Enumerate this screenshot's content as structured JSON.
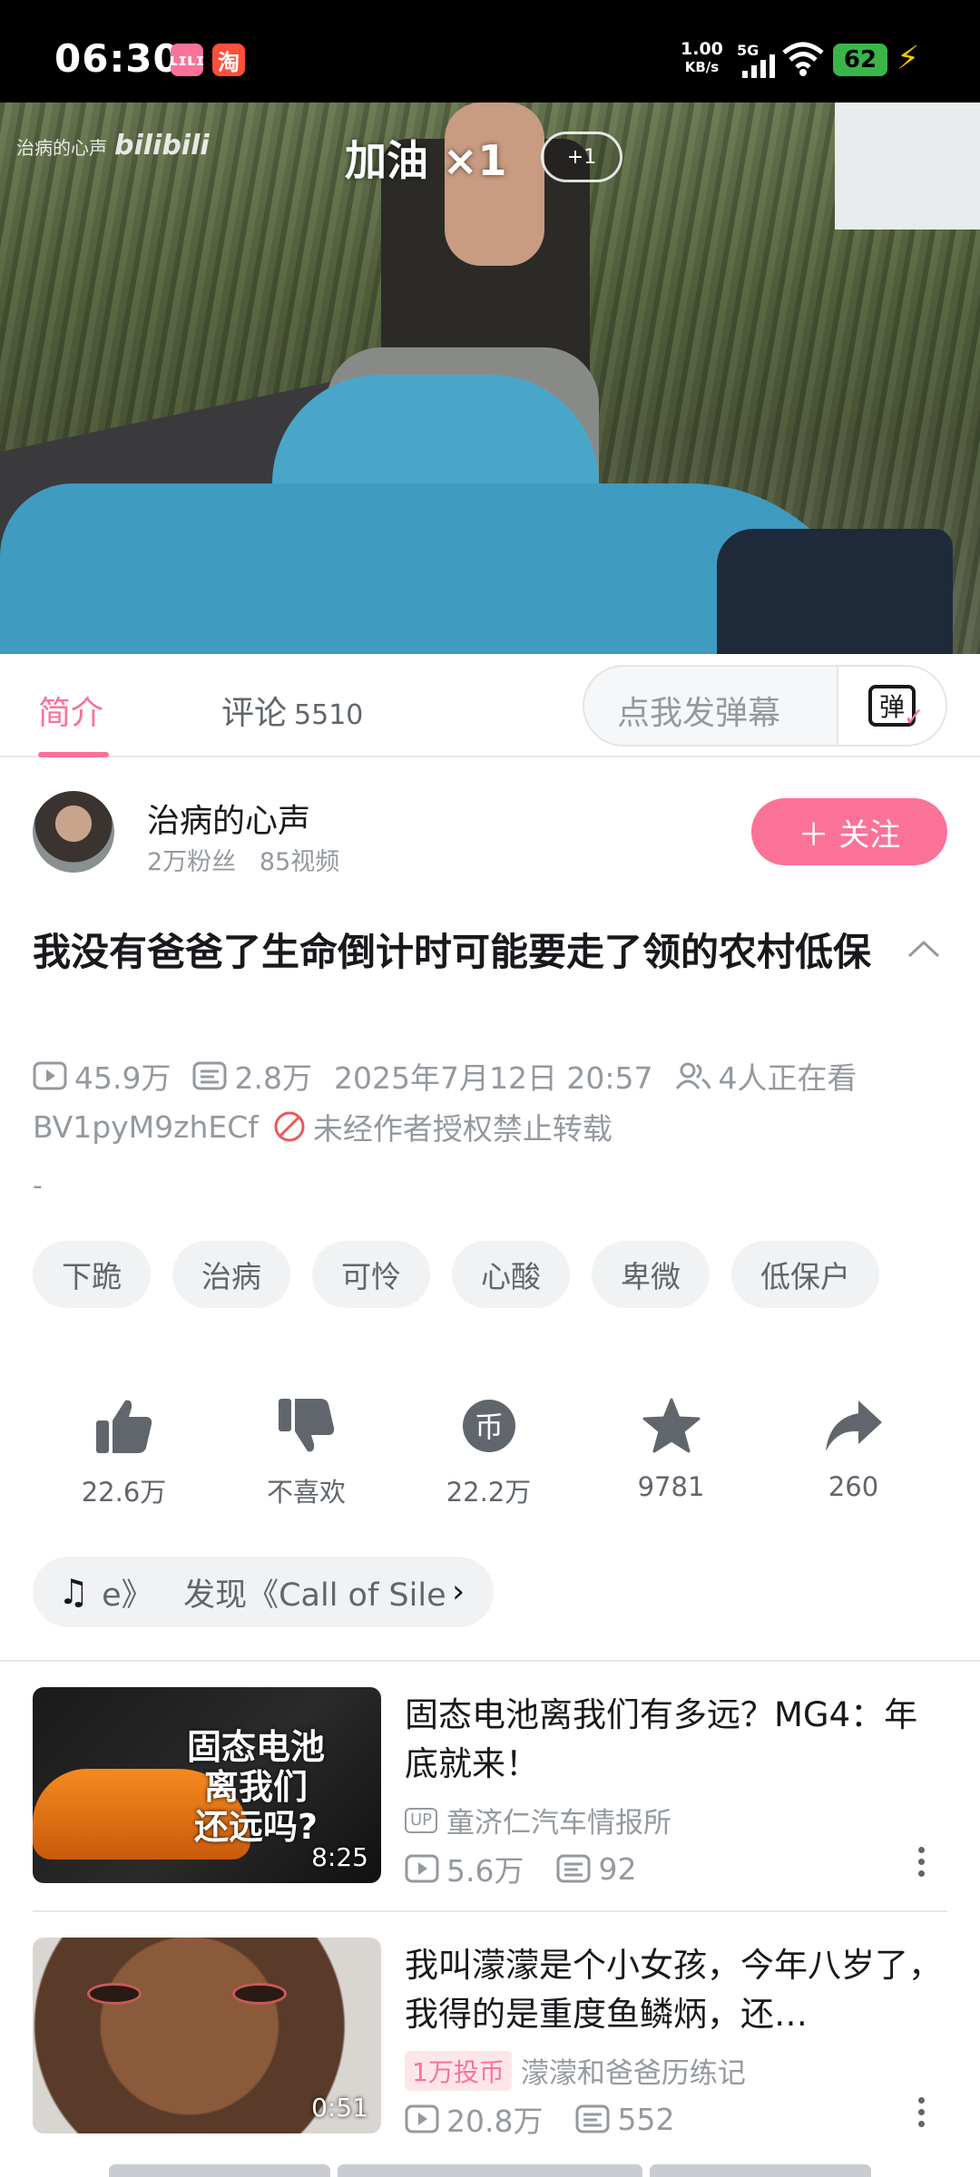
{
  "status_bar": {
    "time": "06:30",
    "app_icons": [
      "bilibili-icon",
      "taobao-icon"
    ],
    "app_labels": {
      "bili": "ʟɪʟɪ",
      "taobao": "淘"
    },
    "net_speed_value": "1.00",
    "net_speed_unit": "KB/s",
    "network": "5G",
    "battery": "62"
  },
  "video": {
    "watermark_text": "治病的心声",
    "watermark_logo": "bilibili",
    "cheer_text": "加油 ×1",
    "cheer_badge": "+1"
  },
  "tabs": {
    "intro": "简介",
    "comments": "评论",
    "comment_count": "5510",
    "danmaku_placeholder": "点我发弹幕",
    "danmaku_button": "弹"
  },
  "uploader": {
    "name": "治病的心声",
    "stats": "2万粉丝   85视频",
    "follow_label": "＋ 关注"
  },
  "video_info": {
    "title": "我没有爸爸了生命倒计时可能要走了领的农村低保",
    "plays": "45.9万",
    "danmaku": "2.8万",
    "date": "2025年7月12日 20:57",
    "watching": "4人正在看",
    "bvid": "BV1pyM9zhECf",
    "copyright": "未经作者授权禁止转载",
    "desc": "-"
  },
  "tags": [
    "下跪",
    "治病",
    "可怜",
    "心酸",
    "卑微",
    "低保户"
  ],
  "actions": {
    "like": "22.6万",
    "dislike": "不喜欢",
    "coin": "22.2万",
    "coin_glyph": "币",
    "favorite": "9781",
    "share": "260"
  },
  "music": {
    "prev_text": "e》",
    "text": "发现《Call of Sile",
    "chevron": "›"
  },
  "recommendations": [
    {
      "thumb_text": "固态电池\n离我们\n还远吗?",
      "duration": "8:25",
      "title": "固态电池离我们有多远？MG4：年底就来！",
      "uploader_badge": "UP",
      "uploader": "童济仁汽车情报所",
      "plays": "5.6万",
      "danmaku": "92"
    },
    {
      "duration": "0:51",
      "title": "我叫濛濛是个小女孩，今年八岁了，我得的是重度鱼鳞炳，还…",
      "coin_badge": "1万投币",
      "uploader": "濛濛和爸爸历练记",
      "plays": "20.8万",
      "danmaku": "552"
    }
  ],
  "colors": {
    "accent": "#fb7299",
    "text_primary": "#18191c",
    "text_secondary": "#9499a0",
    "text_muted": "#61666d"
  }
}
